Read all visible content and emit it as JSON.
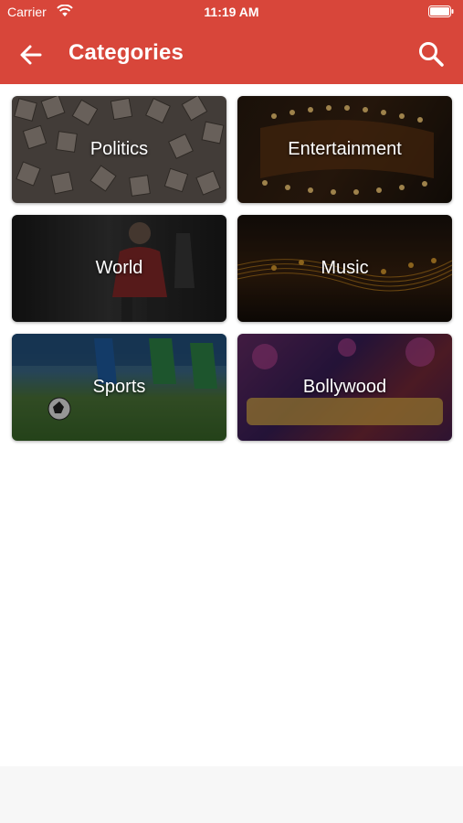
{
  "status_bar": {
    "carrier": "Carrier",
    "time": "11:19 AM"
  },
  "header": {
    "title": "Categories",
    "back_icon": "arrow-left-icon",
    "search_icon": "search-icon"
  },
  "categories": [
    {
      "label": "Politics"
    },
    {
      "label": "Entertainment"
    },
    {
      "label": "World"
    },
    {
      "label": "Music"
    },
    {
      "label": "Sports"
    },
    {
      "label": "Bollywood"
    }
  ],
  "colors": {
    "header_bg": "#d8463a",
    "header_text": "#ffffff",
    "page_bg": "#ffffff"
  }
}
